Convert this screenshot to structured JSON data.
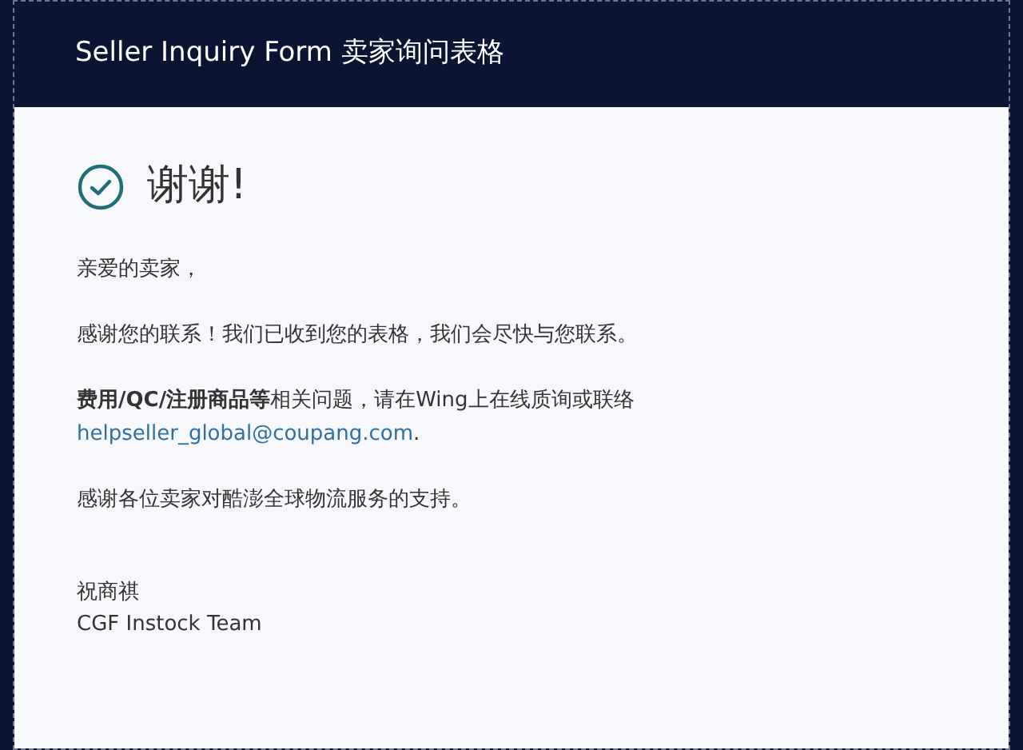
{
  "header": {
    "title": "Seller Inquiry Form 卖家询问表格"
  },
  "heading": "谢谢!",
  "paragraphs": [
    {
      "text": "亲爱的卖家，"
    },
    {
      "text": "感谢您的联系！我们已收到您的表格，我们会尽快与您联系。"
    },
    {
      "text": "**费用/QC/注册商品等**相关问题，请在Wing上在线质询或联络 ",
      "link": "helpseller_global@coupang.com",
      "after": "."
    },
    {
      "text": "感谢各位卖家对酷澎全球物流服务的支持。"
    }
  ],
  "signature": [
    "祝商祺",
    "CGF Instock Team"
  ]
}
